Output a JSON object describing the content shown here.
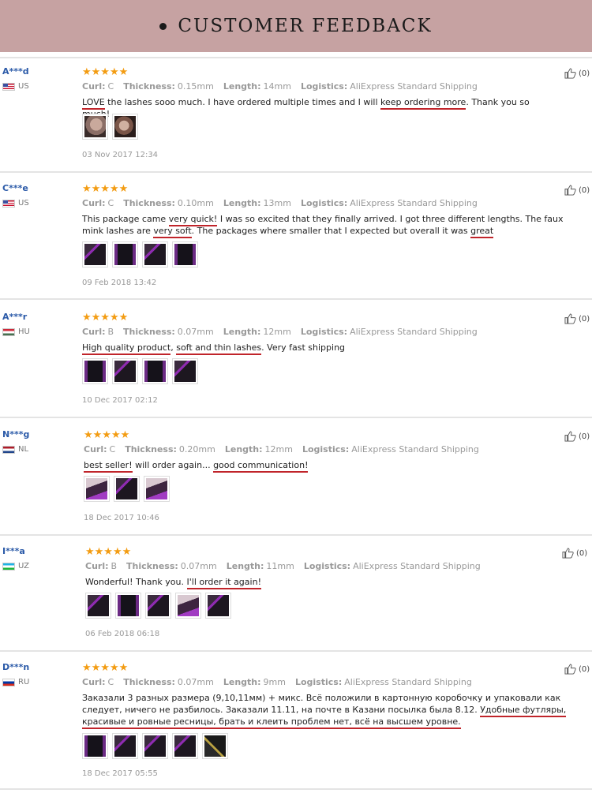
{
  "banner": {
    "title": "CUSTOMER FEEDBACK"
  },
  "labels": {
    "curl": "Curl:",
    "thickness": "Thickness:",
    "length": "Length:",
    "logistics": "Logistics:"
  },
  "reviews": [
    {
      "user": "A***d",
      "country": "US",
      "flag": "us",
      "stars": "★★★★★",
      "curl": "C",
      "thickness": "0.15mm",
      "length": "14mm",
      "logistics": "AliExpress Standard Shipping",
      "text": [
        {
          "t": "LOVE",
          "u": true
        },
        {
          "t": " the lashes sooo much. I have ordered multiple times and I will ",
          "u": false
        },
        {
          "t": "keep ordering more",
          "u": true
        },
        {
          "t": ". Thank you so much!",
          "u": false
        }
      ],
      "thumbs": [
        "t-face",
        "t-face2"
      ],
      "date": "03 Nov 2017 12:34",
      "likes": "(0)"
    },
    {
      "user": "C***e",
      "country": "US",
      "flag": "us",
      "stars": "★★★★★",
      "curl": "C",
      "thickness": "0.10mm",
      "length": "13mm",
      "logistics": "AliExpress Standard Shipping",
      "text": [
        {
          "t": "This package came ",
          "u": false
        },
        {
          "t": "very quick!",
          "u": true
        },
        {
          "t": " I was so excited that they finally arrived. I got three different lengths. The faux mink lashes are ",
          "u": false
        },
        {
          "t": "very soft",
          "u": true
        },
        {
          "t": ". The packages where smaller that I expected but overall it was ",
          "u": false
        },
        {
          "t": "great",
          "u": true
        }
      ],
      "thumbs": [
        "t-tray",
        "t-tray2",
        "t-tray",
        "t-tray2"
      ],
      "date": "09 Feb 2018 13:42",
      "likes": "(0)"
    },
    {
      "user": "A***r",
      "country": "HU",
      "flag": "hu",
      "stars": "★★★★★",
      "curl": "B",
      "thickness": "0.07mm",
      "length": "12mm",
      "logistics": "AliExpress Standard Shipping",
      "text": [
        {
          "t": "High quality product",
          "u": true
        },
        {
          "t": ", ",
          "u": false
        },
        {
          "t": "soft and thin lashes",
          "u": true
        },
        {
          "t": ". Very fast shipping",
          "u": false
        }
      ],
      "thumbs": [
        "t-tray2",
        "t-tray",
        "t-tray2",
        "t-tray"
      ],
      "date": "10 Dec 2017 02:12",
      "likes": "(0)"
    },
    {
      "user": "N***g",
      "country": "NL",
      "flag": "nl",
      "stars": "★★★★★",
      "curl": "C",
      "thickness": "0.20mm",
      "length": "12mm",
      "logistics": "AliExpress Standard Shipping",
      "text": [
        {
          "t": "best seller!",
          "u": true
        },
        {
          "t": " will order again... ",
          "u": false
        },
        {
          "t": "good communication!",
          "u": true
        }
      ],
      "thumbs": [
        "t-tray3",
        "t-tray",
        "t-tray3"
      ],
      "date": "18 Dec 2017 10:46",
      "likes": "(0)"
    },
    {
      "user": "I***a",
      "country": "UZ",
      "flag": "uz",
      "stars": "★★★★★",
      "curl": "B",
      "thickness": "0.07mm",
      "length": "11mm",
      "logistics": "AliExpress Standard Shipping",
      "text": [
        {
          "t": "Wonderful! Thank you. ",
          "u": false
        },
        {
          "t": "I'll order it again!",
          "u": true
        }
      ],
      "thumbs": [
        "t-tray",
        "t-tray2",
        "t-tray",
        "t-tray3",
        "t-tray"
      ],
      "date": "06 Feb 2018 06:18",
      "likes": "(0)"
    },
    {
      "user": "D***n",
      "country": "RU",
      "flag": "ru",
      "stars": "★★★★★",
      "curl": "C",
      "thickness": "0.07mm",
      "length": "9mm",
      "logistics": "AliExpress Standard Shipping",
      "text": [
        {
          "t": "Заказали 3 разных размера (9,10,11мм) + микс. Всё положили в картонную коробочку и упаковали как следует, ничего не разбилось. Заказали 11.11, на почте в Казани посылка была 8.12. ",
          "u": false
        },
        {
          "t": "Удобные футляры, красивые и ровные ресницы, брать и клеить проблем нет, всё на высшем уровне.",
          "u": true
        }
      ],
      "thumbs": [
        "t-tray2",
        "t-tray",
        "t-tray",
        "t-tray",
        "t-tray4"
      ],
      "date": "18 Dec 2017 05:55",
      "likes": "(0)"
    }
  ]
}
